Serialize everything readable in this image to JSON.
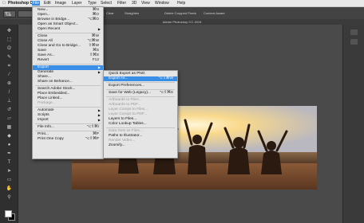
{
  "menubar": {
    "apple_icon": "apple-icon",
    "items": [
      "Photoshop CC",
      "File",
      "Edit",
      "Image",
      "Layer",
      "Type",
      "Select",
      "Filter",
      "3D",
      "View",
      "Window",
      "Help"
    ]
  },
  "options_bar": {
    "clear_label": "Clear",
    "straighten_label": "Straighten",
    "delete_cropped_label": "Delete Cropped Pixels",
    "content_aware_label": "Content-Aware"
  },
  "document_title": "Adobe Photoshop CC 2015",
  "file_menu": [
    {
      "label": "New...",
      "shortcut": "⌘N",
      "enabled": true
    },
    {
      "label": "Open...",
      "shortcut": "⌘O",
      "enabled": true
    },
    {
      "label": "Browse in Bridge...",
      "shortcut": "⌥⌘O",
      "enabled": true
    },
    {
      "label": "Open as Smart Object...",
      "shortcut": "",
      "enabled": true
    },
    {
      "label": "Open Recent",
      "shortcut": "",
      "enabled": true,
      "submenu": true
    },
    {
      "sep": true
    },
    {
      "label": "Close",
      "shortcut": "⌘W",
      "enabled": true
    },
    {
      "label": "Close All",
      "shortcut": "⌥⌘W",
      "enabled": true
    },
    {
      "label": "Close and Go to Bridge...",
      "shortcut": "⇧⌘W",
      "enabled": true
    },
    {
      "label": "Save",
      "shortcut": "⌘S",
      "enabled": true
    },
    {
      "label": "Save As...",
      "shortcut": "⇧⌘S",
      "enabled": true
    },
    {
      "label": "Revert",
      "shortcut": "F12",
      "enabled": true
    },
    {
      "sep": true
    },
    {
      "label": "Export",
      "shortcut": "",
      "enabled": true,
      "submenu": true,
      "highlighted": true
    },
    {
      "label": "Generate",
      "shortcut": "",
      "enabled": true,
      "submenu": true
    },
    {
      "label": "Share...",
      "shortcut": "",
      "enabled": true
    },
    {
      "label": "Share on Behance...",
      "shortcut": "",
      "enabled": true
    },
    {
      "sep": true
    },
    {
      "label": "Search Adobe Stock...",
      "shortcut": "",
      "enabled": true
    },
    {
      "label": "Place Embedded...",
      "shortcut": "",
      "enabled": true
    },
    {
      "label": "Place Linked...",
      "shortcut": "",
      "enabled": true
    },
    {
      "label": "Package...",
      "shortcut": "",
      "enabled": false
    },
    {
      "sep": true
    },
    {
      "label": "Automate",
      "shortcut": "",
      "enabled": true,
      "submenu": true
    },
    {
      "label": "Scripts",
      "shortcut": "",
      "enabled": true,
      "submenu": true
    },
    {
      "label": "Import",
      "shortcut": "",
      "enabled": true,
      "submenu": true
    },
    {
      "sep": true
    },
    {
      "label": "File Info...",
      "shortcut": "⌥⇧⌘I",
      "enabled": true
    },
    {
      "sep": true
    },
    {
      "label": "Print...",
      "shortcut": "⌘P",
      "enabled": true
    },
    {
      "label": "Print One Copy",
      "shortcut": "⌥⇧⌘P",
      "enabled": true
    }
  ],
  "export_submenu": [
    {
      "label": "Quick Export as PNG",
      "shortcut": "",
      "enabled": true
    },
    {
      "label": "Export As...",
      "shortcut": "⌥⇧⌘W",
      "enabled": true,
      "highlighted": true
    },
    {
      "sep": true
    },
    {
      "label": "Export Preferences...",
      "shortcut": "",
      "enabled": true
    },
    {
      "sep": true
    },
    {
      "label": "Save for Web (Legacy)...",
      "shortcut": "⌥⇧⌘S",
      "enabled": true
    },
    {
      "sep": true
    },
    {
      "label": "Artboards to Files...",
      "shortcut": "",
      "enabled": false
    },
    {
      "label": "Artboards to PDF...",
      "shortcut": "",
      "enabled": false
    },
    {
      "label": "Layer Comps to Files...",
      "shortcut": "",
      "enabled": false
    },
    {
      "label": "Layer Comps to PDF...",
      "shortcut": "",
      "enabled": false
    },
    {
      "label": "Layers to Files...",
      "shortcut": "",
      "enabled": true
    },
    {
      "label": "Color Lookup Tables...",
      "shortcut": "",
      "enabled": true
    },
    {
      "sep": true
    },
    {
      "label": "Data Sets as Files...",
      "shortcut": "",
      "enabled": false
    },
    {
      "label": "Paths to Illustrator...",
      "shortcut": "",
      "enabled": true
    },
    {
      "label": "Render Video...",
      "shortcut": "",
      "enabled": false
    },
    {
      "label": "Zoomify...",
      "shortcut": "",
      "enabled": true
    }
  ],
  "tools": [
    "move-tool-icon",
    "marquee-tool-icon",
    "lasso-tool-icon",
    "quick-select-tool-icon",
    "crop-tool-icon",
    "eyedropper-tool-icon",
    "healing-brush-icon",
    "brush-tool-icon",
    "clone-stamp-icon",
    "history-brush-icon",
    "eraser-tool-icon",
    "gradient-tool-icon",
    "blur-tool-icon",
    "dodge-tool-icon",
    "pen-tool-icon",
    "type-tool-icon",
    "path-select-icon",
    "rectangle-tool-icon",
    "hand-tool-icon",
    "zoom-tool-icon"
  ],
  "colors": {
    "menu_highlight": "#3a8ee6",
    "menu_bg": "#e5e5e5",
    "toolbar_bg": "#2f2f2f",
    "canvas_bg": "#4a4a4a",
    "foreground_swatch": "#ffffff",
    "background_swatch": "#000000"
  }
}
